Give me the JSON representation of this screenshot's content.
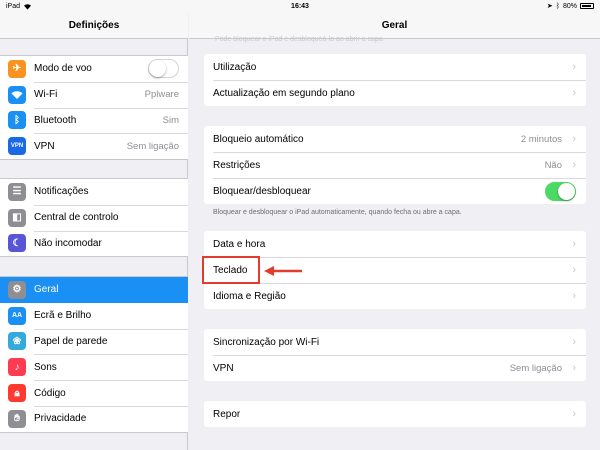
{
  "status": {
    "device": "iPad",
    "time": "16:43",
    "battery": "80%"
  },
  "left": {
    "title": "Definições",
    "groups": [
      {
        "items": [
          {
            "label": "Modo de voo",
            "icon": "airplane-icon",
            "color": "#f7931e",
            "toggle": false
          },
          {
            "label": "Wi-Fi",
            "value": "Pplware",
            "icon": "wifi-icon",
            "color": "#1a8ff4"
          },
          {
            "label": "Bluetooth",
            "value": "Sim",
            "icon": "bluetooth-icon",
            "color": "#1a8ff4"
          },
          {
            "label": "VPN",
            "value": "Sem ligação",
            "icon": "vpn-icon",
            "color": "#1a6ae8"
          }
        ]
      },
      {
        "items": [
          {
            "label": "Notificações",
            "icon": "notifications-icon",
            "color": "#8e8e93"
          },
          {
            "label": "Central de controlo",
            "icon": "control-center-icon",
            "color": "#8e8e93"
          },
          {
            "label": "Não incomodar",
            "icon": "moon-icon",
            "color": "#5856d6"
          }
        ]
      },
      {
        "items": [
          {
            "label": "Geral",
            "icon": "gear-icon",
            "color": "#8e8e93",
            "selected": true
          },
          {
            "label": "Ecrã e Brilho",
            "icon": "display-icon",
            "color": "#1a8ff4"
          },
          {
            "label": "Papel de parede",
            "icon": "wallpaper-icon",
            "color": "#34aadc"
          },
          {
            "label": "Sons",
            "icon": "sound-icon",
            "color": "#ff3b52"
          },
          {
            "label": "Código",
            "icon": "lock-icon",
            "color": "#ff3b30"
          },
          {
            "label": "Privacidade",
            "icon": "hand-icon",
            "color": "#8e8e93"
          }
        ]
      }
    ]
  },
  "right": {
    "title": "Geral",
    "faded_note": "Pode bloquear o iPad e desbloqueá-lo ao abrir a capa",
    "cards": [
      [
        {
          "label": "Utilização"
        },
        {
          "label": "Actualização em segundo plano"
        }
      ],
      [
        {
          "label": "Bloqueio automático",
          "value": "2 minutos"
        },
        {
          "label": "Restrições",
          "value": "Não"
        },
        {
          "label": "Bloquear/desbloquear",
          "toggle": true
        }
      ],
      [
        {
          "label": "Data e hora"
        },
        {
          "label": "Teclado"
        },
        {
          "label": "Idioma e Região"
        }
      ],
      [
        {
          "label": "Sincronização por Wi-Fi"
        },
        {
          "label": "VPN",
          "value": "Sem ligação"
        }
      ],
      [
        {
          "label": "Repor"
        }
      ]
    ],
    "footnote": "Bloquear e desbloquear o iPad automaticamente, quando fecha ou abre a capa."
  }
}
